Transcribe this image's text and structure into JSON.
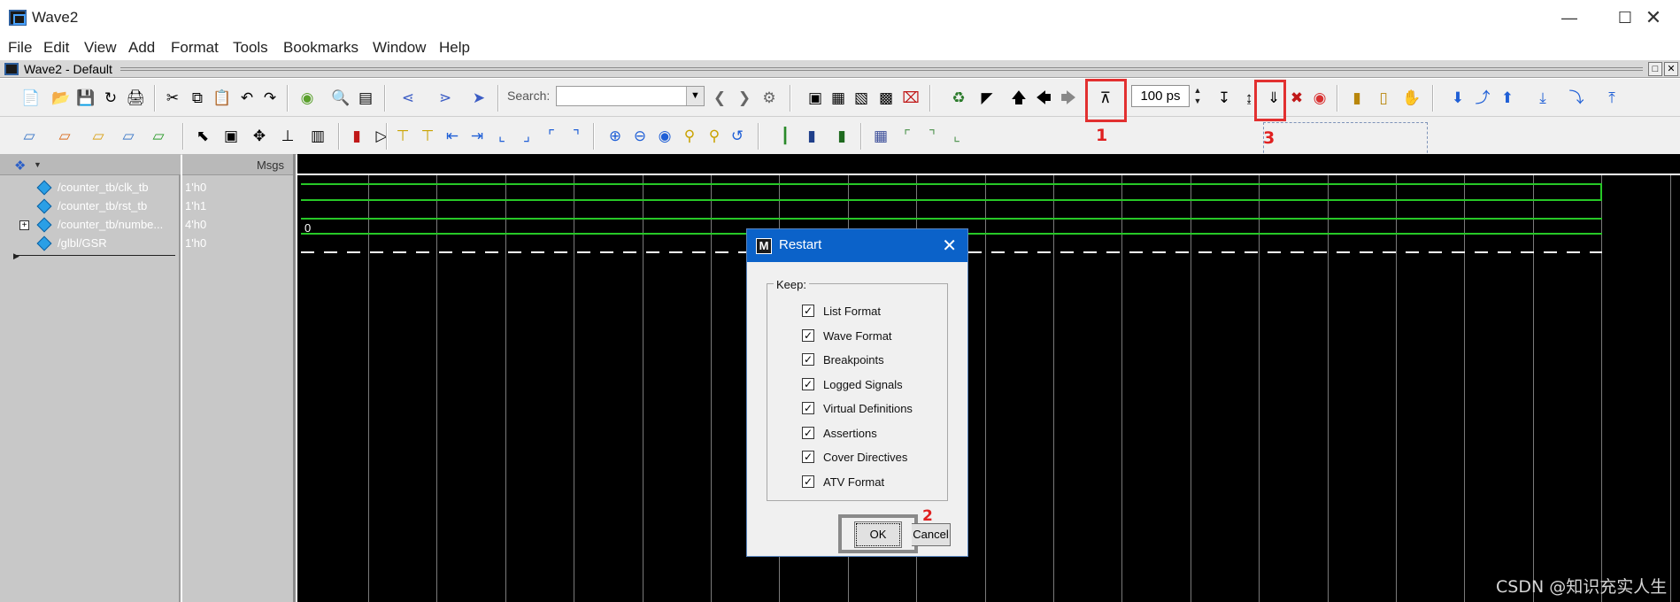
{
  "window": {
    "title": "Wave2"
  },
  "menu": [
    "File",
    "Edit",
    "View",
    "Add",
    "Format",
    "Tools",
    "Bookmarks",
    "Window",
    "Help"
  ],
  "wave_window": {
    "title": "Wave2 - Default"
  },
  "toolbar": {
    "search_label": "Search:",
    "search_value": "",
    "run_length": "100 ps"
  },
  "columns": {
    "msgs": "Msgs"
  },
  "signals": [
    {
      "name": "/counter_tb/clk_tb",
      "value": "1'h0",
      "expandable": false
    },
    {
      "name": "/counter_tb/rst_tb",
      "value": "1'h1",
      "expandable": false
    },
    {
      "name": "/counter_tb/numbe...",
      "value": "4'h0",
      "expandable": true
    },
    {
      "name": "/glbl/GSR",
      "value": "1'h0",
      "expandable": false
    }
  ],
  "bus_value": "0",
  "annotations": {
    "one": "1",
    "two": "2",
    "three": "3"
  },
  "dialog": {
    "title": "Restart",
    "group_label": "Keep:",
    "options": [
      {
        "label": "List Format",
        "checked": true
      },
      {
        "label": "Wave Format",
        "checked": true
      },
      {
        "label": "Breakpoints",
        "checked": true
      },
      {
        "label": "Logged Signals",
        "checked": true
      },
      {
        "label": "Virtual Definitions",
        "checked": true
      },
      {
        "label": "Assertions",
        "checked": true
      },
      {
        "label": "Cover Directives",
        "checked": true
      },
      {
        "label": "ATV Format",
        "checked": true
      }
    ],
    "ok_label": "OK",
    "cancel_label": "Cancel"
  },
  "watermark": "CSDN @知识充实人生",
  "colors": {
    "dialog_title": "#0b62c9",
    "wave_green": "#27c827",
    "highlight": "#e23030"
  }
}
